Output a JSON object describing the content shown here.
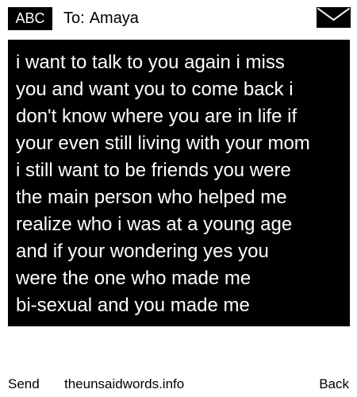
{
  "header": {
    "input_mode": "ABC",
    "recipient_label": "To:",
    "recipient_name": "Amaya",
    "envelope_icon": "envelope-icon"
  },
  "message": {
    "text": "i want to talk to you again i miss\nyou and want you to come back i\ndon't know where you are in life if\nyour even still living with your mom\ni still want to be friends you were\nthe main person who helped me\nrealize who i was at a young age\nand if your wondering yes you\nwere the one who made me\nbi-sexual and you made me"
  },
  "footer": {
    "send_label": "Send",
    "site_label": "theunsaidwords.info",
    "back_label": "Back"
  },
  "colors": {
    "background": "#ffffff",
    "message_background": "#000000",
    "message_text": "#ffffff",
    "text": "#000000"
  }
}
